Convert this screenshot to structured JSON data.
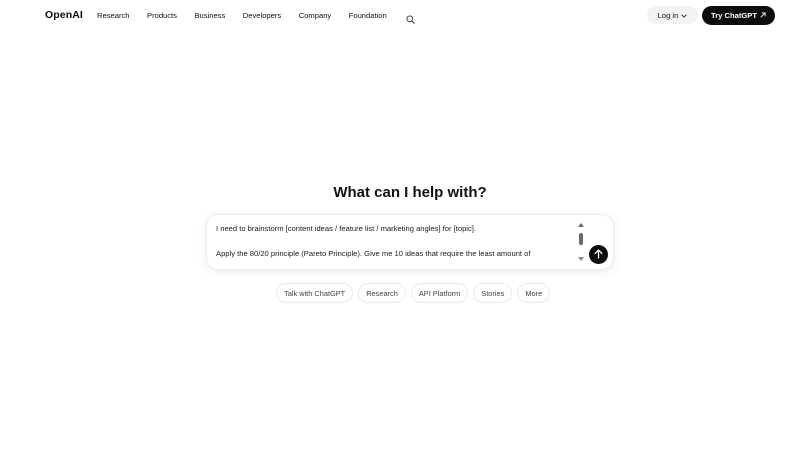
{
  "header": {
    "logo": "OpenAI",
    "nav": [
      "Research",
      "Products",
      "Business",
      "Developers",
      "Company",
      "Foundation"
    ],
    "search_icon": "search-icon",
    "login_label": "Log in",
    "try_label": "Try ChatGPT",
    "try_icon": "arrow-up-right-icon"
  },
  "main": {
    "heading": "What can I help with?",
    "composer": {
      "line1": "I need to brainstorm [content ideas / feature list / marketing angles] for [topic].",
      "line2": "Apply the 80/20 principle (Pareto Principle). Give me 10 ideas that require the least amount of",
      "send_icon": "arrow-up-icon"
    },
    "chips": [
      "Talk with ChatGPT",
      "Research",
      "API Platform",
      "Stories",
      "More"
    ]
  },
  "colors": {
    "primary": "#0d0d0d",
    "background": "#ffffff",
    "chip_border": "#ececec"
  }
}
